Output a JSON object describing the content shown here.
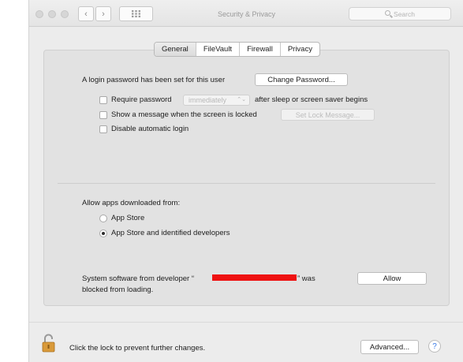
{
  "window": {
    "title": "Security & Privacy",
    "nav_back": "‹",
    "nav_forward": "›",
    "grid_icon": "grid-icon"
  },
  "search": {
    "placeholder": "Search"
  },
  "tabs": [
    {
      "label": "General",
      "active": true
    },
    {
      "label": "FileVault",
      "active": false
    },
    {
      "label": "Firewall",
      "active": false
    },
    {
      "label": "Privacy",
      "active": false
    }
  ],
  "general": {
    "login_text": "A login password has been set for this user",
    "change_password_button": "Change Password...",
    "require_password_label": "Require password",
    "require_password_value": "immediately",
    "require_password_checked": false,
    "after_sleep_text": "after sleep or screen saver begins",
    "show_message_label": "Show a message when the screen is locked",
    "show_message_checked": false,
    "set_lock_message_button": "Set Lock Message...",
    "disable_autologin_label": "Disable automatic login",
    "disable_autologin_checked": false
  },
  "apps": {
    "heading": "Allow apps downloaded from:",
    "options": [
      {
        "label": "App Store",
        "selected": false
      },
      {
        "label": "App Store and identified developers",
        "selected": true
      }
    ]
  },
  "system_software": {
    "line1_prefix": "System software from developer “",
    "line1_suffix": "” was",
    "line2": "blocked from loading.",
    "allow_button": "Allow",
    "redaction_color": "#ee1111"
  },
  "footer": {
    "lock_text": "Click the lock to prevent further changes.",
    "advanced_button": "Advanced...",
    "help_label": "?"
  },
  "colors": {
    "accent": "#3a7be8",
    "lock": "#d99a3a"
  }
}
